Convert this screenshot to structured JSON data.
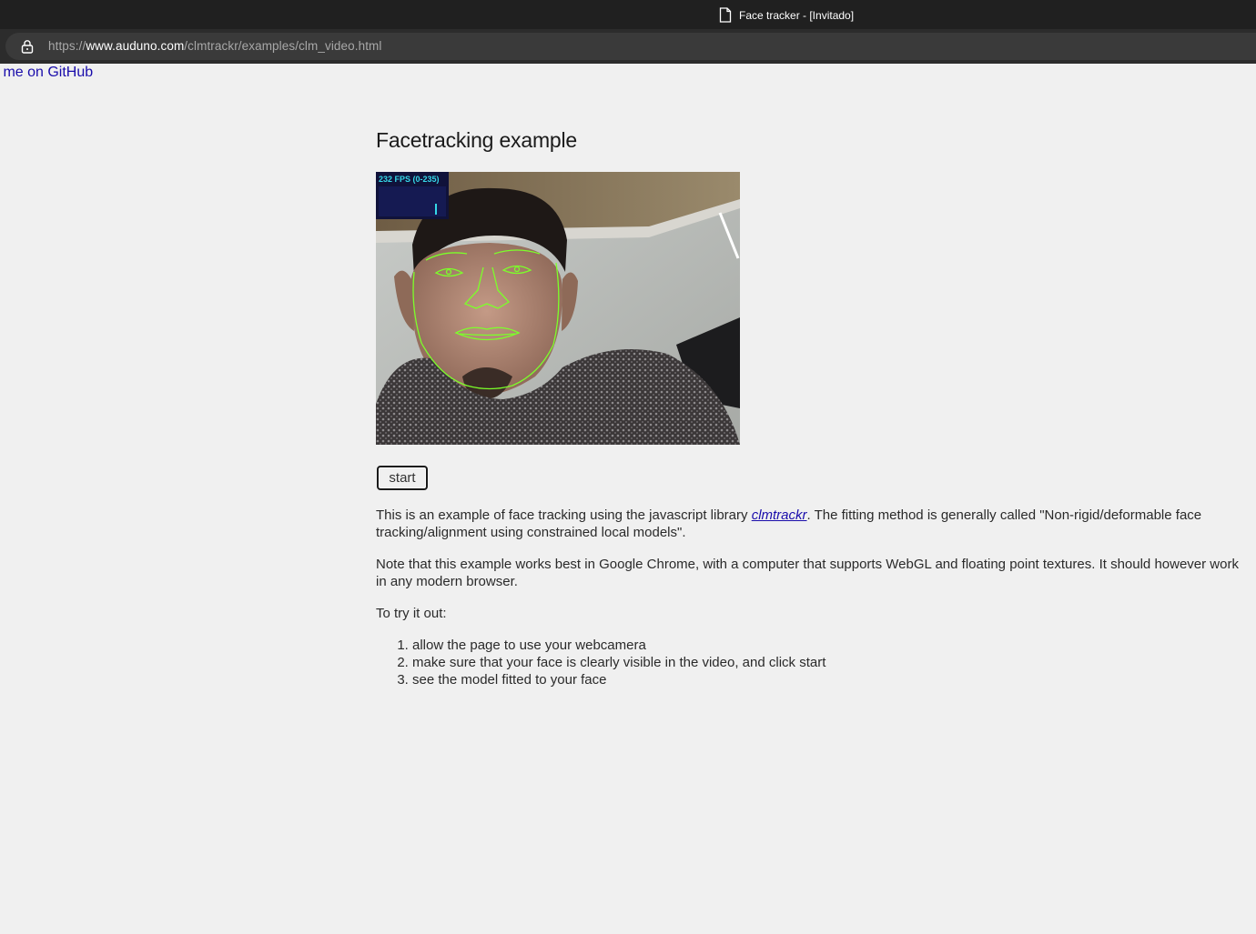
{
  "window": {
    "title": "Face tracker - [Invitado]"
  },
  "address_bar": {
    "url_scheme": "https://",
    "url_host": "www.auduno.com",
    "url_path": "/clmtrackr/examples/clm_video.html"
  },
  "page": {
    "github_link": "k me on GitHub",
    "heading": "Facetracking example",
    "fps": {
      "label": "232 FPS (0-235)",
      "value": 232,
      "range": [
        0,
        235
      ]
    },
    "start_button": "start",
    "intro": {
      "text_before": "This is an example of face tracking using the javascript library ",
      "link": "clmtrackr",
      "text_after": ". The fitting method is generally called \"Non-rigid/deformable face tracking/alignment using constrained local models\"."
    },
    "note": "Note that this example works best in Google Chrome, with a computer that supports WebGL and floating point textures. It should however work in any modern browser.",
    "try_label": "To try it out:",
    "steps": [
      "allow the page to use your webcamera",
      "make sure that your face is clearly visible in the video, and click start",
      "see the model fitted to your face"
    ]
  },
  "colors": {
    "page_background": "#f0f0f0",
    "link": "#1a0dab",
    "tracker_lines": "#7cff2a",
    "fps_text": "#35d8e8"
  }
}
